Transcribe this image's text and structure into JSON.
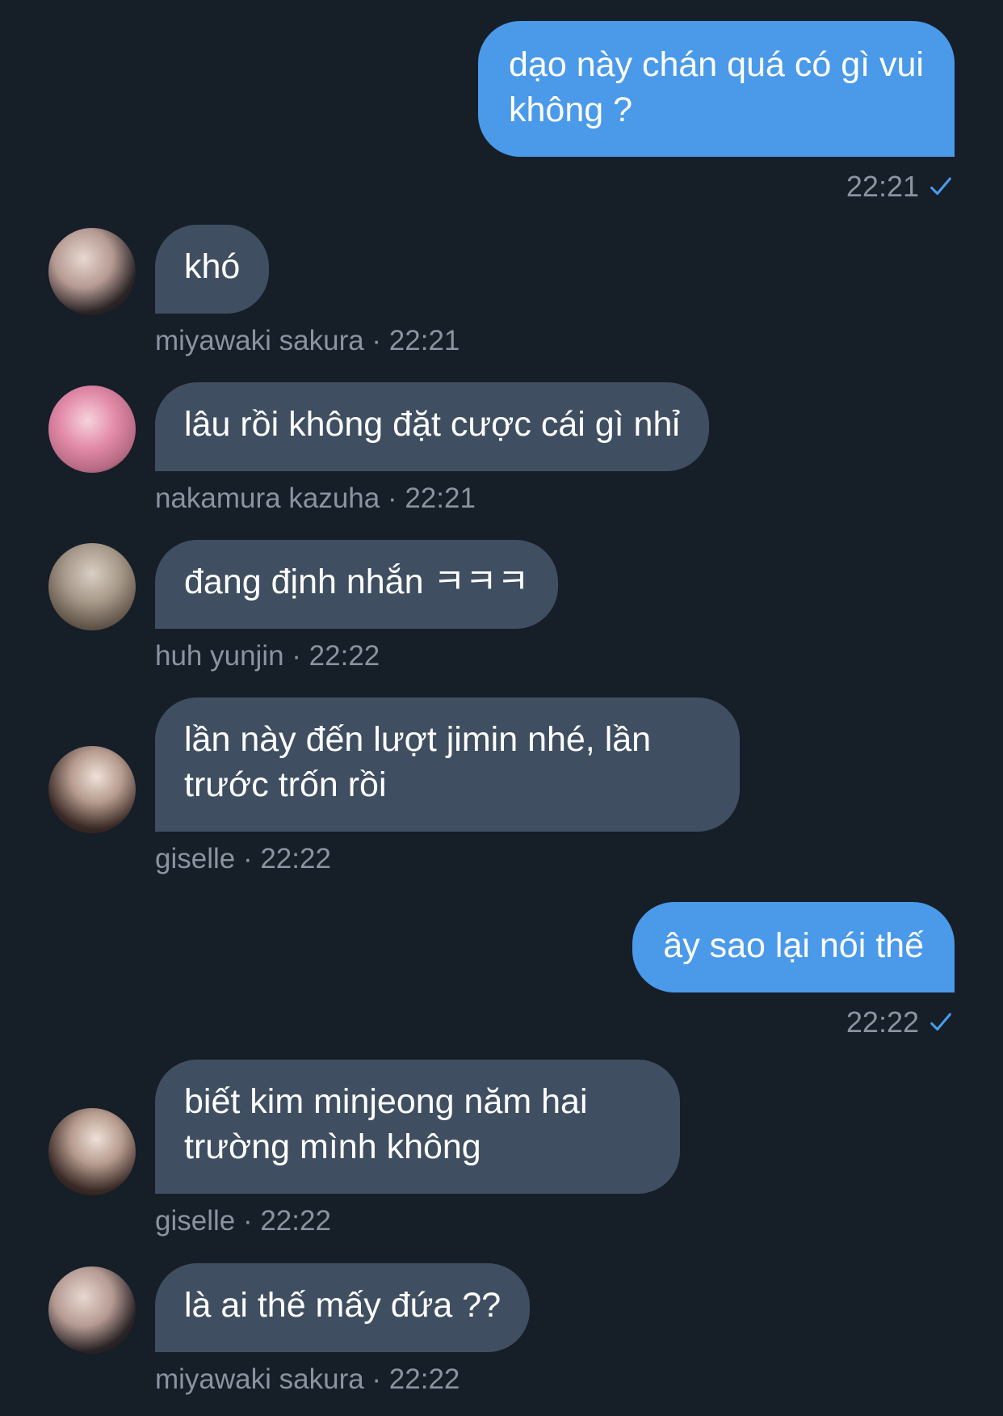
{
  "conversation": {
    "messages": [
      {
        "direction": "out",
        "text": "dạo này chán quá có gì vui không ?",
        "time": "22:21",
        "status_icon": "check-icon"
      },
      {
        "direction": "in",
        "text": "khó",
        "sender": "miyawaki sakura",
        "time": "22:21",
        "meta": "miyawaki sakura · 22:21",
        "avatar": "avatar-sakura"
      },
      {
        "direction": "in",
        "text": "lâu rồi không đặt cược cái gì nhỉ",
        "sender": "nakamura kazuha",
        "time": "22:21",
        "meta": "nakamura kazuha · 22:21",
        "avatar": "avatar-kazuha"
      },
      {
        "direction": "in",
        "text": "đang định nhắn ㅋㅋㅋ",
        "sender": "huh yunjin",
        "time": "22:22",
        "meta": "huh yunjin · 22:22",
        "avatar": "avatar-yunjin"
      },
      {
        "direction": "in",
        "text": "lần này đến lượt jimin nhé, lần trước trốn rồi",
        "sender": "giselle",
        "time": "22:22",
        "meta": "giselle · 22:22",
        "avatar": "avatar-giselle"
      },
      {
        "direction": "out",
        "text": "ây sao lại nói thế",
        "time": "22:22",
        "status_icon": "check-icon"
      },
      {
        "direction": "in",
        "text": "biết kim minjeong năm hai trường mình không",
        "sender": "giselle",
        "time": "22:22",
        "meta": "giselle · 22:22",
        "avatar": "avatar-giselle"
      },
      {
        "direction": "in",
        "text": "là ai thế mấy đứa ??",
        "sender": "miyawaki sakura",
        "time": "22:22",
        "meta": "miyawaki sakura · 22:22",
        "avatar": "avatar-sakura"
      }
    ]
  },
  "colors": {
    "background": "#161e28",
    "outgoing_bubble": "#4a9ae9",
    "incoming_bubble": "#3f4f61",
    "meta_text": "#8a93a0",
    "check": "#4a9ae9"
  }
}
